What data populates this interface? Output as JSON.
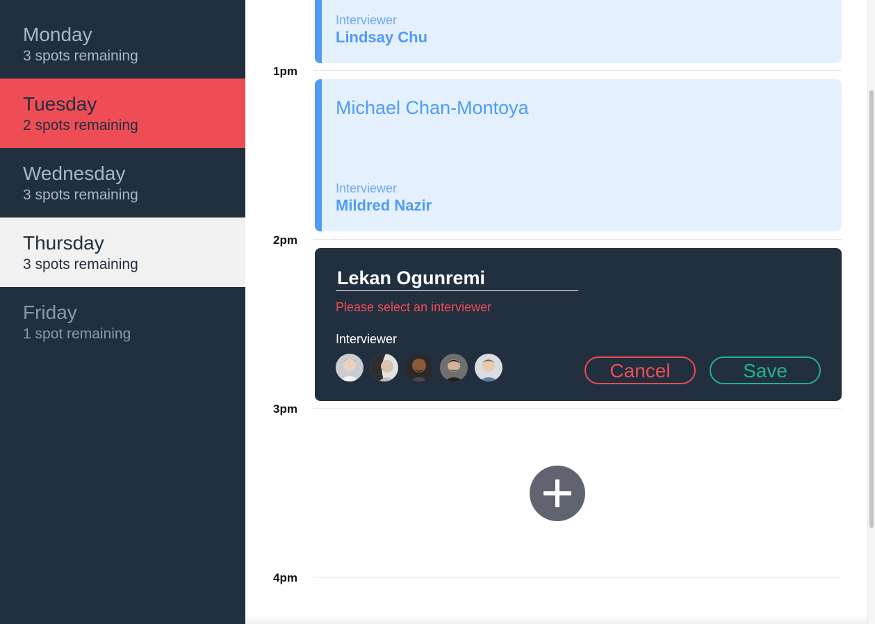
{
  "sidebar": {
    "days": [
      {
        "name": "Monday",
        "spots": "3 spots remaining"
      },
      {
        "name": "Tuesday",
        "spots": "2 spots remaining"
      },
      {
        "name": "Wednesday",
        "spots": "3 spots remaining"
      },
      {
        "name": "Thursday",
        "spots": "3 spots remaining"
      },
      {
        "name": "Friday",
        "spots": "1 spot remaining"
      }
    ]
  },
  "schedule": {
    "times": [
      "1pm",
      "2pm",
      "3pm",
      "4pm"
    ],
    "appointments": [
      {
        "interviewer_label": "Interviewer",
        "interviewer": "Lindsay Chu"
      },
      {
        "student": "Michael Chan-Montoya",
        "interviewer_label": "Interviewer",
        "interviewer": "Mildred Nazir"
      }
    ],
    "form": {
      "student_name": "Lekan Ogunremi",
      "error": "Please select an interviewer",
      "interviewer_heading": "Interviewer",
      "avatars": [
        "avatar-1",
        "avatar-2",
        "avatar-3",
        "avatar-4",
        "avatar-5"
      ],
      "cancel_label": "Cancel",
      "save_label": "Save"
    },
    "add_icon": "plus-icon"
  },
  "colors": {
    "sidebar_bg": "#222f3e",
    "selected_day": "#ef4d55",
    "appointment_accent": "#4e9cf5",
    "error": "#ef4d55",
    "save": "#21b48c"
  }
}
